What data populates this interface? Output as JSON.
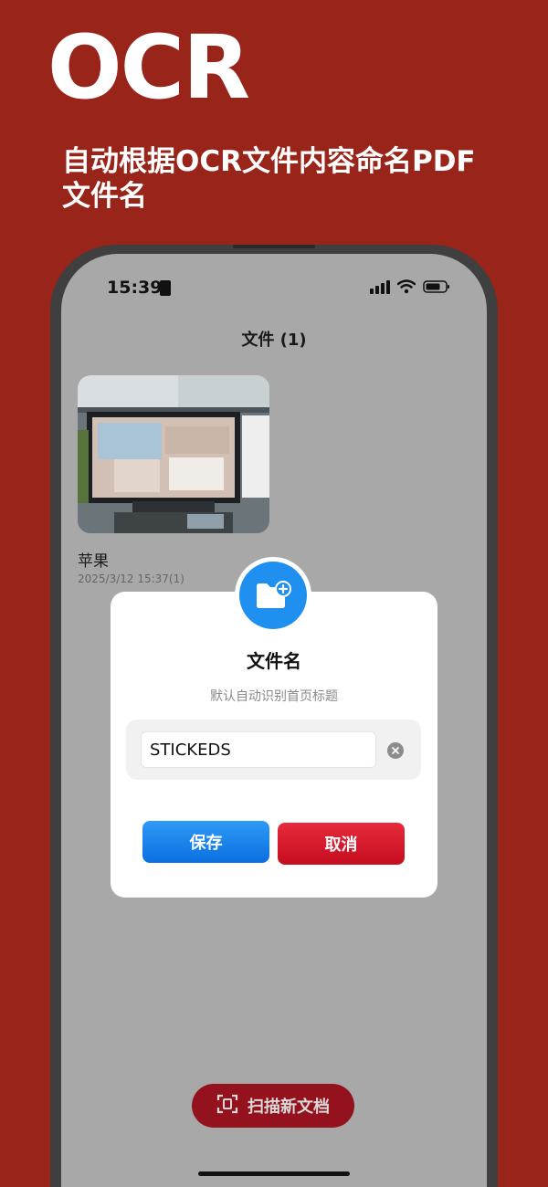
{
  "promo": {
    "title": "OCR",
    "subtitle": "自动根据OCR文件内容命名PDF文件名"
  },
  "status_bar": {
    "time": "15:39"
  },
  "nav": {
    "title": "文件 (1)"
  },
  "file": {
    "name": "苹果",
    "meta": "2025/3/12 15:37(1)"
  },
  "dialog": {
    "title": "文件名",
    "subtitle": "默认自动识别首页标题",
    "input_value": "STICKEDS",
    "save_label": "保存",
    "cancel_label": "取消"
  },
  "scan_button": {
    "label": "扫描新文档"
  },
  "colors": {
    "background": "#992419",
    "screen": "#a8a8a8",
    "save": "#1f8ff0",
    "cancel": "#d81b2c",
    "scan": "#93121e"
  },
  "icons": [
    "sim-icon",
    "signal-icon",
    "wifi-icon",
    "battery-icon",
    "folder-plus-icon",
    "clear-icon",
    "scan-icon"
  ]
}
